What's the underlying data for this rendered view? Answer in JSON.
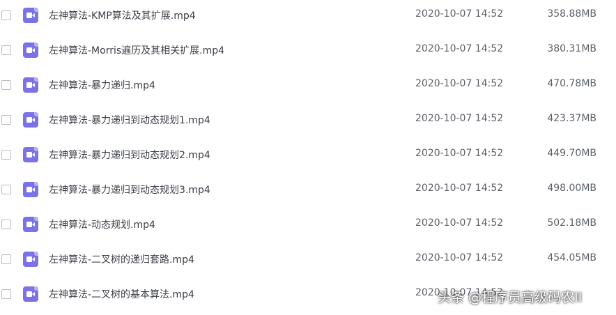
{
  "files": [
    {
      "name": "左神算法-KMP算法及其扩展.mp4",
      "date": "2020-10-07 14:52",
      "size": "358.88MB",
      "icon": "video-file-icon"
    },
    {
      "name": "左神算法-Morris遍历及其相关扩展.mp4",
      "date": "2020-10-07 14:52",
      "size": "380.31MB",
      "icon": "video-file-icon"
    },
    {
      "name": "左神算法-暴力递归.mp4",
      "date": "2020-10-07 14:52",
      "size": "470.78MB",
      "icon": "video-file-icon"
    },
    {
      "name": "左神算法-暴力递归到动态规划1.mp4",
      "date": "2020-10-07 14:52",
      "size": "423.37MB",
      "icon": "video-file-icon"
    },
    {
      "name": "左神算法-暴力递归到动态规划2.mp4",
      "date": "2020-10-07 14:52",
      "size": "449.70MB",
      "icon": "video-file-icon"
    },
    {
      "name": "左神算法-暴力递归到动态规划3.mp4",
      "date": "2020-10-07 14:52",
      "size": "498.00MB",
      "icon": "video-file-icon"
    },
    {
      "name": "左神算法-动态规划.mp4",
      "date": "2020-10-07 14:52",
      "size": "502.18MB",
      "icon": "video-file-icon"
    },
    {
      "name": "左神算法-二叉树的递归套路.mp4",
      "date": "2020-10-07 14:52",
      "size": "454.05MB",
      "icon": "video-file-icon"
    },
    {
      "name": "左神算法-二叉树的基本算法.mp4",
      "date": "2020-10-07 14:52",
      "size": "",
      "icon": "video-file-icon"
    }
  ],
  "watermark": "头条 @程序员高级码农II",
  "colors": {
    "icon_bg": "#7b72e8",
    "text": "#3b3f47",
    "meta_text": "#5c6068"
  }
}
